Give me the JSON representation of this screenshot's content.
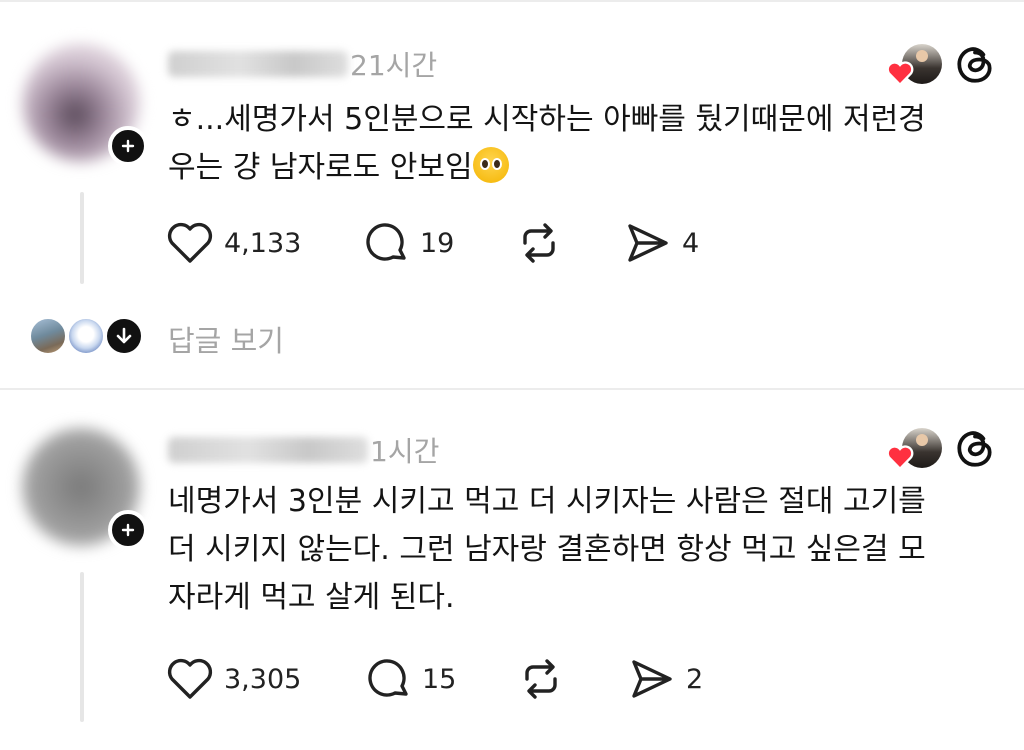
{
  "posts": [
    {
      "username": "",
      "time": "21시간",
      "text_line1": "ㅎ...세명가서 5인분으로 시작하는 아빠를 뒀기때문에 저런경",
      "text_line2": "우는 걍 남자로도 안보임",
      "emoji": "pleading-face-emoji",
      "likes": "4,133",
      "comments": "19",
      "reposts": "",
      "shares": "4",
      "avatar_color": "#c9b7c9"
    },
    {
      "username": "",
      "time": "1시간",
      "text_line1": "네명가서 3인분 시키고 먹고 더 시키자는 사람은 절대 고기를",
      "text_line2": "더 시키지 않는다. 그런 남자랑 결혼하면 항상 먹고 싶은걸 모",
      "text_line3": "자라게 먹고 살게 된다.",
      "likes": "3,305",
      "comments": "15",
      "reposts": "",
      "shares": "2",
      "avatar_color": "#8a8a8a"
    }
  ],
  "replies": {
    "label": "답글 보기"
  },
  "icons": {
    "like": "heart-icon",
    "comment": "comment-bubble-icon",
    "repost": "repost-icon",
    "share": "send-icon",
    "follow": "plus-icon",
    "threads": "threads-logo-icon",
    "expand": "arrow-down-icon"
  },
  "colors": {
    "like_red": "#ff3040",
    "muted": "#a5a5a5"
  }
}
